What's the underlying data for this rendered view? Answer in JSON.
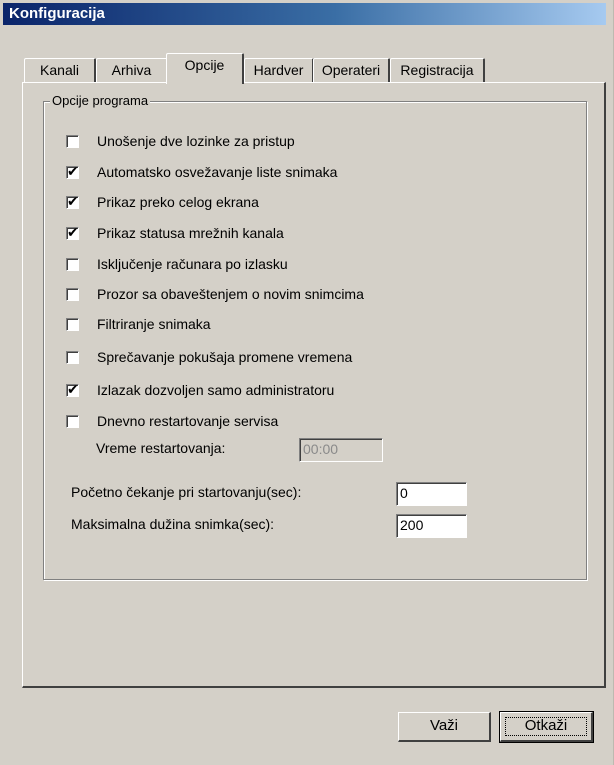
{
  "window": {
    "title": "Konfiguracija"
  },
  "tabs": [
    {
      "label": "Kanali",
      "active": false
    },
    {
      "label": "Arhiva",
      "active": false
    },
    {
      "label": "Opcije",
      "active": true
    },
    {
      "label": "Hardver",
      "active": false
    },
    {
      "label": "Operateri",
      "active": false
    },
    {
      "label": "Registracija",
      "active": false
    }
  ],
  "group": {
    "title": "Opcije programa",
    "options": [
      {
        "label": "Unošenje dve lozinke za pristup",
        "checked": false
      },
      {
        "label": "Automatsko osvežavanje liste snimaka",
        "checked": true
      },
      {
        "label": "Prikaz preko celog ekrana",
        "checked": true
      },
      {
        "label": "Prikaz statusa mrežnih kanala",
        "checked": true
      },
      {
        "label": "Isključenje računara po izlasku",
        "checked": false
      },
      {
        "label": "Prozor sa obaveštenjem o novim snimcima",
        "checked": false
      },
      {
        "label": "Filtriranje snimaka",
        "checked": false
      },
      {
        "label": "Sprečavanje pokušaja promene vremena",
        "checked": false
      },
      {
        "label": "Izlazak dozvoljen samo administratoru",
        "checked": true
      },
      {
        "label": "Dnevno restartovanje servisa",
        "checked": false
      }
    ],
    "restart_time": {
      "label": "Vreme restartovanja:",
      "value": "00:00"
    },
    "startup_wait": {
      "label": "Početno čekanje pri startovanju(sec):",
      "value": "0"
    },
    "max_length": {
      "label": "Maksimalna dužina snimka(sec):",
      "value": "200"
    }
  },
  "buttons": {
    "save": "Važi",
    "cancel": "Otkaži"
  }
}
